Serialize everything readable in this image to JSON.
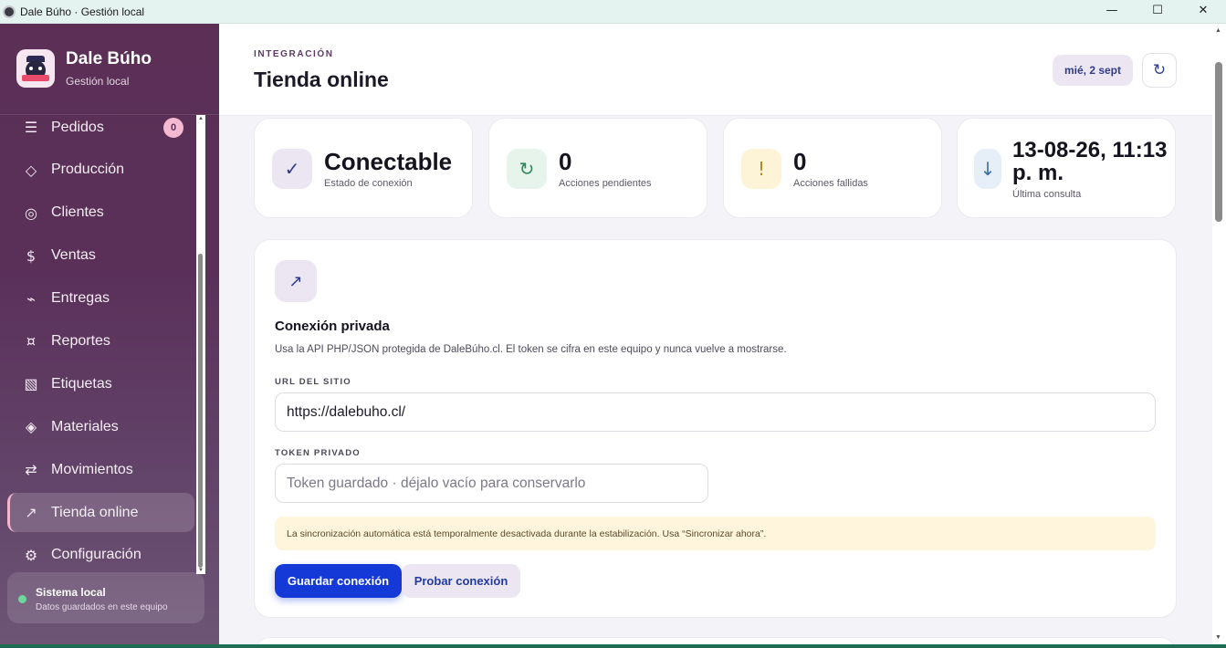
{
  "window": {
    "title": "Dale Búho · Gestión local",
    "controls": {
      "minimize": "—",
      "maximize": "☐",
      "close": "✕"
    }
  },
  "sidebar": {
    "brand": {
      "name": "Dale Búho",
      "subtitle": "Gestión local",
      "logo_icon": "owl-logo-icon"
    },
    "items": [
      {
        "label": "Pedidos",
        "icon": "list-icon",
        "glyph": "☰",
        "badge": "0"
      },
      {
        "label": "Producción",
        "icon": "diamond-icon",
        "glyph": "◇"
      },
      {
        "label": "Clientes",
        "icon": "target-icon",
        "glyph": "◎"
      },
      {
        "label": "Ventas",
        "icon": "dollar-icon",
        "glyph": "$"
      },
      {
        "label": "Entregas",
        "icon": "route-icon",
        "glyph": "⌁"
      },
      {
        "label": "Reportes",
        "icon": "report-icon",
        "glyph": "¤"
      },
      {
        "label": "Etiquetas",
        "icon": "label-icon",
        "glyph": "▧"
      },
      {
        "label": "Materiales",
        "icon": "materials-icon",
        "glyph": "◈"
      },
      {
        "label": "Movimientos",
        "icon": "swap-icon",
        "glyph": "⇄"
      },
      {
        "label": "Tienda online",
        "icon": "arrow-up-right-icon",
        "glyph": "↗",
        "active": true
      },
      {
        "label": "Configuración",
        "icon": "gear-icon",
        "glyph": "⚙"
      }
    ],
    "status": {
      "title": "Sistema local",
      "subtitle": "Datos guardados en este equipo",
      "color": "#6ed69a"
    }
  },
  "header": {
    "eyebrow": "INTEGRACIÓN",
    "title": "Tienda online",
    "date": "mié, 2 sept",
    "refresh_glyph": "↻"
  },
  "stats": [
    {
      "value": "Conectable",
      "label": "Estado de conexión",
      "icon": "check-icon",
      "glyph": "✓",
      "bg": "#ece6f2",
      "fg": "#2f3c8c"
    },
    {
      "value": "0",
      "label": "Acciones pendientes",
      "icon": "refresh-icon",
      "glyph": "↻",
      "bg": "#e6f4ec",
      "fg": "#2e8a5a"
    },
    {
      "value": "0",
      "label": "Acciones fallidas",
      "icon": "warning-icon",
      "glyph": "!",
      "bg": "#fdf3d6",
      "fg": "#b8861d"
    },
    {
      "value": "13-08-26, 11:13 p. m.",
      "label": "Última consulta",
      "icon": "arrow-down-icon",
      "glyph": "↓",
      "bg": "#e6eff8",
      "fg": "#3a6ea5"
    }
  ],
  "connection": {
    "icon_glyph": "↗",
    "title": "Conexión privada",
    "description": "Usa la API PHP/JSON protegida de DaleBúho.cl. El token se cifra en este equipo y nunca vuelve a mostrarse.",
    "url_label": "URL DEL SITIO",
    "url_value": "https://dalebuho.cl/",
    "token_label": "TOKEN PRIVADO",
    "token_placeholder": "Token guardado · déjalo vacío para conservarlo",
    "notice": "La sincronización automática está temporalmente desactivada durante la estabilización. Usa “Sincronizar ahora”.",
    "save_button": "Guardar conexión",
    "test_button": "Probar conexión"
  },
  "colors": {
    "sidebar": "#5b2f56",
    "primary": "#1439d6",
    "notice": "#fef5dc"
  }
}
